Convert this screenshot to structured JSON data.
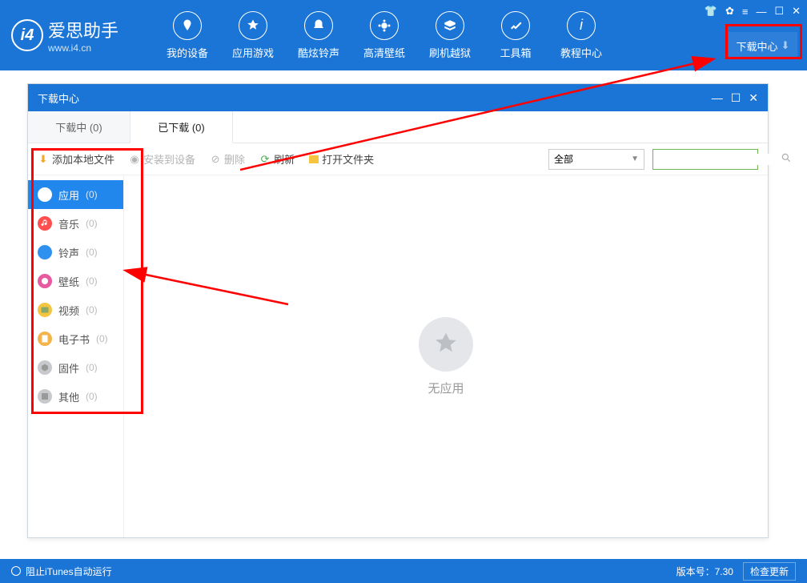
{
  "app": {
    "name": "爱思助手",
    "url": "www.i4.cn"
  },
  "nav": [
    {
      "label": "我的设备"
    },
    {
      "label": "应用游戏"
    },
    {
      "label": "酷炫铃声"
    },
    {
      "label": "高清壁纸"
    },
    {
      "label": "刷机越狱"
    },
    {
      "label": "工具箱"
    },
    {
      "label": "教程中心"
    }
  ],
  "download_center_label": "下载中心",
  "inner": {
    "title": "下载中心",
    "tabs": [
      {
        "label": "下载中  (0)",
        "active": false
      },
      {
        "label": "已下载  (0)",
        "active": true
      }
    ],
    "toolbar": {
      "add_local": "添加本地文件",
      "install": "安装到设备",
      "delete": "删除",
      "refresh": "刷新",
      "open_folder": "打开文件夹",
      "filter_all": "全部"
    },
    "sidebar": [
      {
        "label": "应用",
        "count": "(0)",
        "active": true,
        "color": "#2f91ef",
        "icon": "app"
      },
      {
        "label": "音乐",
        "count": "(0)",
        "color": "#ff4f4f",
        "icon": "music"
      },
      {
        "label": "铃声",
        "count": "(0)",
        "color": "#2f91ef",
        "icon": "bell"
      },
      {
        "label": "壁纸",
        "count": "(0)",
        "color": "#e75aa0",
        "icon": "wallpaper"
      },
      {
        "label": "视频",
        "count": "(0)",
        "color": "#f5c542",
        "icon": "video"
      },
      {
        "label": "电子书",
        "count": "(0)",
        "color": "#f2b44b",
        "icon": "book"
      },
      {
        "label": "固件",
        "count": "(0)",
        "color": "#c7c9cc",
        "icon": "firmware"
      },
      {
        "label": "其他",
        "count": "(0)",
        "color": "#c7c9cc",
        "icon": "other"
      }
    ],
    "empty_text": "无应用"
  },
  "footer": {
    "itunes": "阻止iTunes自动运行",
    "version_label": "版本号：7.30",
    "check_update": "检查更新"
  }
}
